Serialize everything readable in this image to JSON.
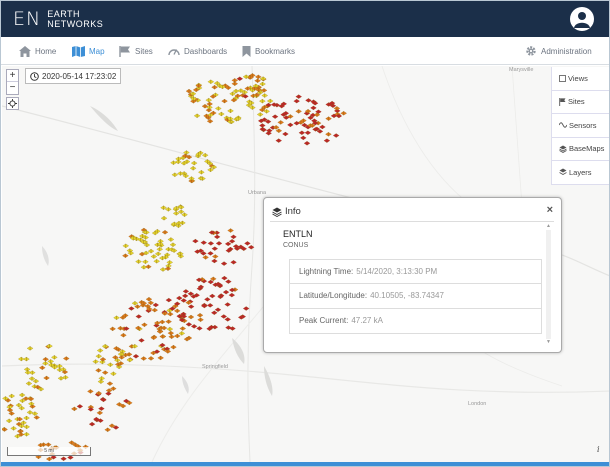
{
  "brand": {
    "mark": "EN",
    "line1": "EARTH",
    "line2": "NETWORKS"
  },
  "nav": {
    "home": "Home",
    "map": "Map",
    "sites": "Sites",
    "dashboards": "Dashboards",
    "bookmarks": "Bookmarks",
    "administration": "Administration"
  },
  "map": {
    "datetime": "2020-05-14 17:23:02",
    "zoom_in": "+",
    "zoom_out": "−",
    "places": {
      "marysville": "Marysville",
      "urbana": "Urbana",
      "springfield": "Springfield",
      "london": "London"
    },
    "scale": "5 mi"
  },
  "side_panel": {
    "views": "Views",
    "sites": "Sites",
    "sensors": "Sensors",
    "basemaps": "BaseMaps",
    "layers": "Layers"
  },
  "info_popup": {
    "title": "Info",
    "close": "×",
    "network": "ENTLN",
    "region": "CONUS",
    "lightning_time_label": "Lightning Time:",
    "lightning_time_value": "5/14/2020, 3:13:30 PM",
    "latlon_label": "Latitude/Longitude:",
    "latlon_value": "40.10505, -83.74347",
    "peak_current_label": "Peak Current:",
    "peak_current_value": "47.27 kA"
  },
  "attribution_icon": "i",
  "colors": {
    "header": "#1b2f49",
    "accent": "#3d8fd6",
    "strike_yellow": "#e6d62c",
    "strike_orange": "#e07a1c",
    "strike_red": "#c4222a"
  }
}
